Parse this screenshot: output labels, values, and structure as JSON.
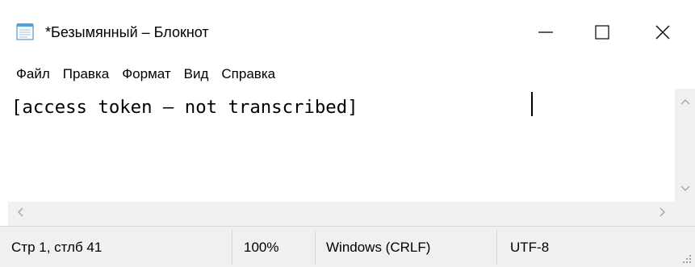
{
  "window": {
    "title": "*Безымянный – Блокнот",
    "app_icon": "notepad-icon",
    "controls": {
      "minimize": "minimize-icon",
      "maximize": "maximize-icon",
      "close": "close-icon"
    }
  },
  "menu": {
    "items": [
      {
        "label": "Файл"
      },
      {
        "label": "Правка"
      },
      {
        "label": "Формат"
      },
      {
        "label": "Вид"
      },
      {
        "label": "Справка"
      }
    ]
  },
  "editor": {
    "text": "[access token — not transcribed]"
  },
  "scrollbars": {
    "vertical": {
      "up": "chevron-up-icon",
      "down": "chevron-down-icon"
    },
    "horizontal": {
      "left": "chevron-left-icon",
      "right": "chevron-right-icon"
    }
  },
  "status": {
    "position": "Стр 1, стлб 41",
    "zoom": "100%",
    "line_endings": "Windows (CRLF)",
    "encoding": "UTF-8"
  },
  "colors": {
    "chrome": "#f0f0f0",
    "separator": "#d7d7d7",
    "scroll_arrow": "#a0a0a0",
    "icon_blue": "#4aa3df"
  }
}
